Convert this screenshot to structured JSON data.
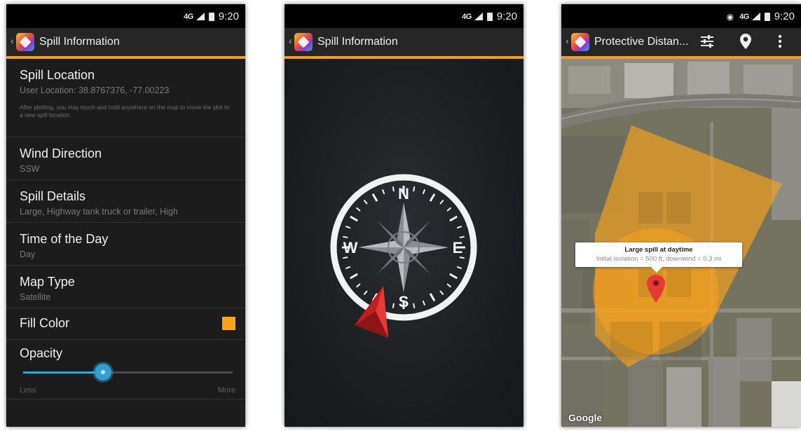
{
  "status_bar": {
    "network": "4G",
    "time": "9:20"
  },
  "screen1": {
    "title": "Spill Information",
    "location": {
      "title": "Spill Location",
      "value": "User Location: 38.8767376, -77.00223",
      "note": "After plotting, you may touch and hold anywhere on the map to move the plot to a new spill location."
    },
    "wind": {
      "title": "Wind Direction",
      "value": "SSW"
    },
    "details": {
      "title": "Spill Details",
      "value": "Large, Highway tank truck or trailer, High"
    },
    "time_of_day": {
      "title": "Time of the Day",
      "value": "Day"
    },
    "map_type": {
      "title": "Map Type",
      "value": "Satellite"
    },
    "fill_color": {
      "title": "Fill Color",
      "color": "#f7a21b"
    },
    "opacity": {
      "title": "Opacity",
      "value": 0.38,
      "min_label": "Less",
      "max_label": "More"
    }
  },
  "screen2": {
    "title": "Spill Information",
    "compass": {
      "north": "N",
      "south": "S",
      "east": "E",
      "west": "W",
      "pointer_color": "#d9282b"
    }
  },
  "screen3": {
    "title": "Protective Distan...",
    "icons": [
      "settings-sliders-icon",
      "map-pin-icon",
      "overflow-menu-icon"
    ],
    "callout": {
      "title": "Large spill at daytime",
      "detail": "Initial isolation = 500 ft, downwind = 0.3 mi"
    },
    "attribution": "Google",
    "zone_color": "#f7a21b",
    "marker_color": "#e53935"
  }
}
